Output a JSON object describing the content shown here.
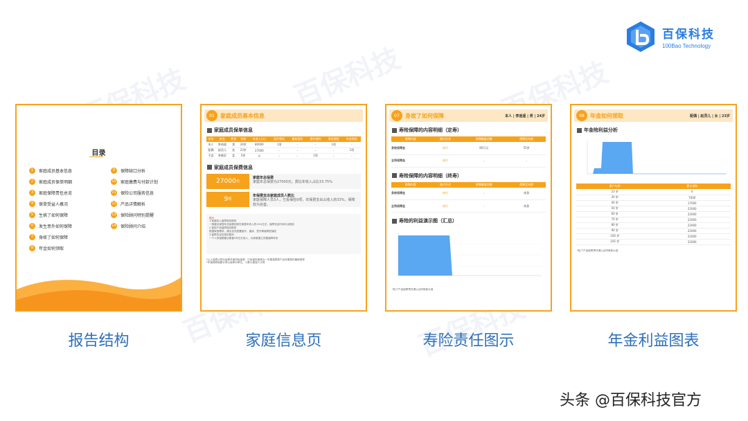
{
  "watermark": "百保科技",
  "brand": {
    "name": "百保科技",
    "sub": "100Bao Technology",
    "color": "#2a7de1"
  },
  "cards": [
    {
      "caption": "报告结构",
      "toc_title": "目录",
      "toc_left": [
        {
          "num": "1",
          "label": "家庭成员基本信息"
        },
        {
          "num": "2",
          "label": "家庭成员保单明细"
        },
        {
          "num": "3",
          "label": "家庭保障责任总览"
        },
        {
          "num": "4",
          "label": "保单受益人概况"
        },
        {
          "num": "5",
          "label": "生病了如何保障"
        },
        {
          "num": "6",
          "label": "发生意外如何保障"
        },
        {
          "num": "7",
          "label": "身故了如何保障"
        },
        {
          "num": "8",
          "label": "年金如何领取"
        }
      ],
      "toc_right": [
        {
          "num": "9",
          "label": "保障缺口分析"
        },
        {
          "num": "10",
          "label": "家庭缴费与付款计划"
        },
        {
          "num": "11",
          "label": "保险公司服务信息"
        },
        {
          "num": "12",
          "label": "产品详情解析"
        },
        {
          "num": "13",
          "label": "保险顾问特别提醒"
        },
        {
          "num": "14",
          "label": "保险顾问介绍"
        }
      ]
    },
    {
      "caption": "家庭信息页",
      "sec_num": "01",
      "sec_title": "家庭成员基本信息",
      "sub1": "家庭成员保单信息",
      "table_headers": [
        "关系",
        "姓名",
        "性别",
        "年龄",
        "年收入(元)",
        "医疗保险",
        "重疾保险",
        "意外保险",
        "寿险保险",
        "年金保险"
      ],
      "table_rows": [
        [
          "本人",
          "李逍遥",
          "男",
          "24岁",
          "80000",
          "1项",
          "-",
          "-",
          "1项",
          "-"
        ],
        [
          "配偶",
          "赵灵儿",
          "女",
          "23岁",
          "27000",
          "-",
          "-",
          "-",
          "-",
          "1项"
        ],
        [
          "子女",
          "李晓灵",
          "女",
          "0岁",
          "0",
          "-",
          "-",
          "1项",
          "-",
          "-"
        ]
      ],
      "sub2": "家庭成员保费信息",
      "premium_value": "27000",
      "premium_unit": "元",
      "premium_title": "家庭年总保费",
      "premium_desc": "家庭年总保费为27000元，费比年收入占比33.75%",
      "count_value": "9",
      "count_unit": "项",
      "count_title": "年保费支出家庭成员人数比",
      "count_desc": "家庭保障人员3人，已投保险9项，年保费支出占收入的33%，保障较为完善。",
      "tip_title": "提示",
      "tip_lines": [
        "1.家庭收入保障规划原则",
        "一般建议家庭年总保费控制在家庭年收入的10%左右，保障充足时间长远规划",
        "2.保险产品保障规划原则",
        "根据家庭需求，建议优先配置医疗、重疾、意外等保障型保险",
        "3.保障充足性规划原则",
        "一个人的保额建议覆盖5年左右收入，为家庭建立完善保障体系"
      ],
      "note1": "*以上保费计算为保单年度初始保费，已经保险保费为一年期保障类产品年缴费的最新费率",
      "note2": "*年保费和保额计算以保单为单位，人数以被保人计算"
    },
    {
      "caption": "寿险责任图示",
      "sec_num": "07",
      "sec_title": "身故了如何保障",
      "sec_right": "本人 | 李逍遥 | 男 | 24岁",
      "block1_title": "寿险保障的内容明细（定寿）",
      "block2_title": "寿险保障的内容明细（终寿）",
      "block_headers": [
        "保障内容",
        "赔付方式",
        "保障额度总额",
        "保障至年龄"
      ],
      "block1_rows": [
        {
          "name": "身故保障金",
          "pay": "给付",
          "amount": "80万元",
          "age": "55岁"
        },
        {
          "name": "全残保障金",
          "pay": "给付",
          "amount": "-",
          "age": "-"
        }
      ],
      "block2_rows": [
        {
          "name": "身故保障金",
          "pay": "给付",
          "amount": "-",
          "age": "终身"
        },
        {
          "name": "全残保障金",
          "pay": "给付",
          "amount": "-",
          "age": "终身"
        }
      ],
      "chart_title": "寿险的利益演示图（汇总）",
      "chart_footnote": "*除了产品保障责任请以合同条款为准"
    },
    {
      "caption": "年金利益图表",
      "sec_num": "08",
      "sec_title": "年金如何领取",
      "sec_right": "配偶 | 赵灵儿 | 女 | 23岁",
      "chart_title": "年金险利益分析",
      "table_headers": [
        "客户年龄",
        "累计领取"
      ],
      "table_rows": [
        [
          "23 岁",
          "0"
        ],
        [
          "30 岁",
          "7000"
        ],
        [
          "40 岁",
          "17000"
        ],
        [
          "50 岁",
          "22000"
        ],
        [
          "60 岁",
          "22000"
        ],
        [
          "70 岁",
          "22000"
        ],
        [
          "80 岁",
          "22000"
        ],
        [
          "90 岁",
          "22000"
        ],
        [
          "100 岁",
          "22000"
        ],
        [
          "105 岁",
          "22000"
        ]
      ],
      "footnote": "*除了产品保障责任请以合同条款为准"
    }
  ],
  "footer": {
    "text": "头条 @百保科技官方",
    "ghost": ""
  }
}
